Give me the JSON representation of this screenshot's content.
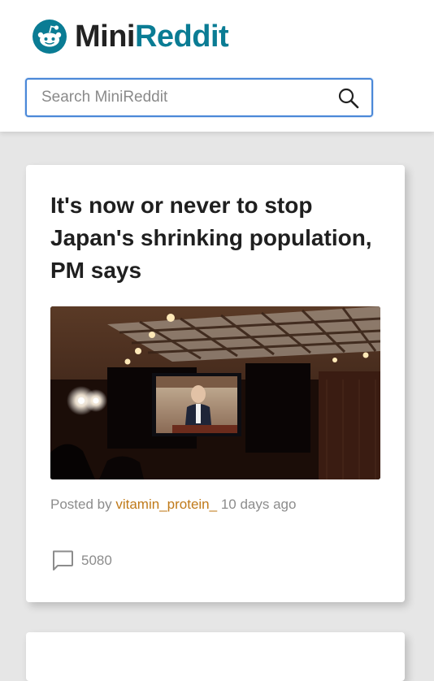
{
  "header": {
    "brand_part1": "Mini",
    "brand_part2": "Reddit",
    "search": {
      "placeholder": "Search MiniReddit",
      "icon": "search-icon"
    }
  },
  "posts": [
    {
      "title": "It's now or never to stop Japan's shrinking population, PM says",
      "image_icon": "post-photo",
      "meta": {
        "posted_by_label": "Posted by",
        "author": "vitamin_protein_",
        "time_ago": "10 days ago"
      },
      "comment_icon": "comment-icon",
      "comment_count": "5080"
    }
  ],
  "colors": {
    "brand_accent": "#0a7c94",
    "author": "#c07a1a",
    "background": "#e6e6e6",
    "search_border": "#4a88d8"
  }
}
